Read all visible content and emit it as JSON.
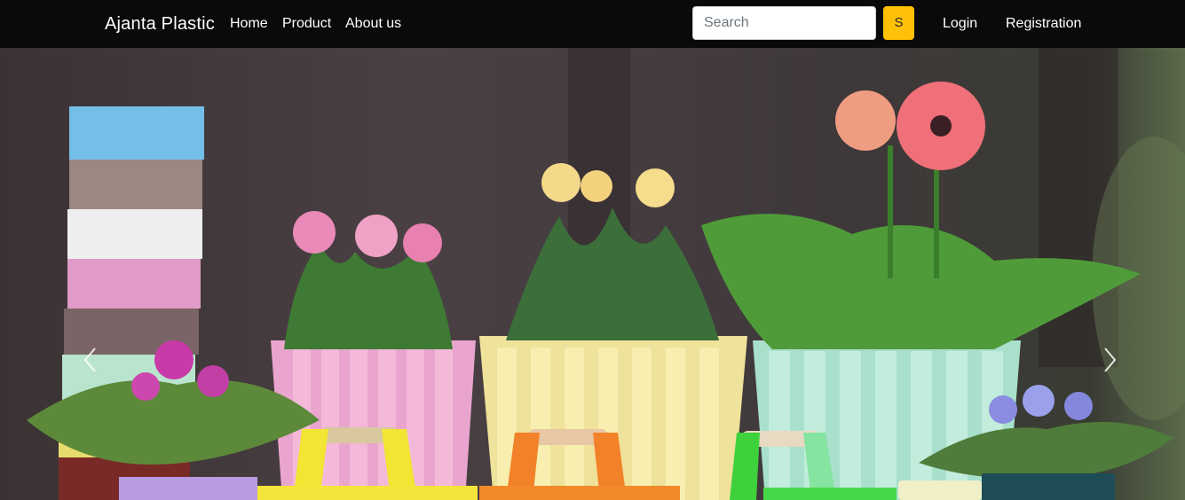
{
  "navbar": {
    "brand": "Ajanta Plastic",
    "links": [
      "Home",
      "Product",
      "About us"
    ],
    "search": {
      "placeholder": "Search",
      "button_label": "S"
    },
    "auth": {
      "login": "Login",
      "registration": "Registration"
    }
  },
  "carousel": {
    "prev_icon": "chevron-left-icon",
    "next_icon": "chevron-right-icon"
  },
  "colors": {
    "navbar_bg": "#0a0a0a",
    "search_button": "#ffc107",
    "text": "#ffffff"
  }
}
